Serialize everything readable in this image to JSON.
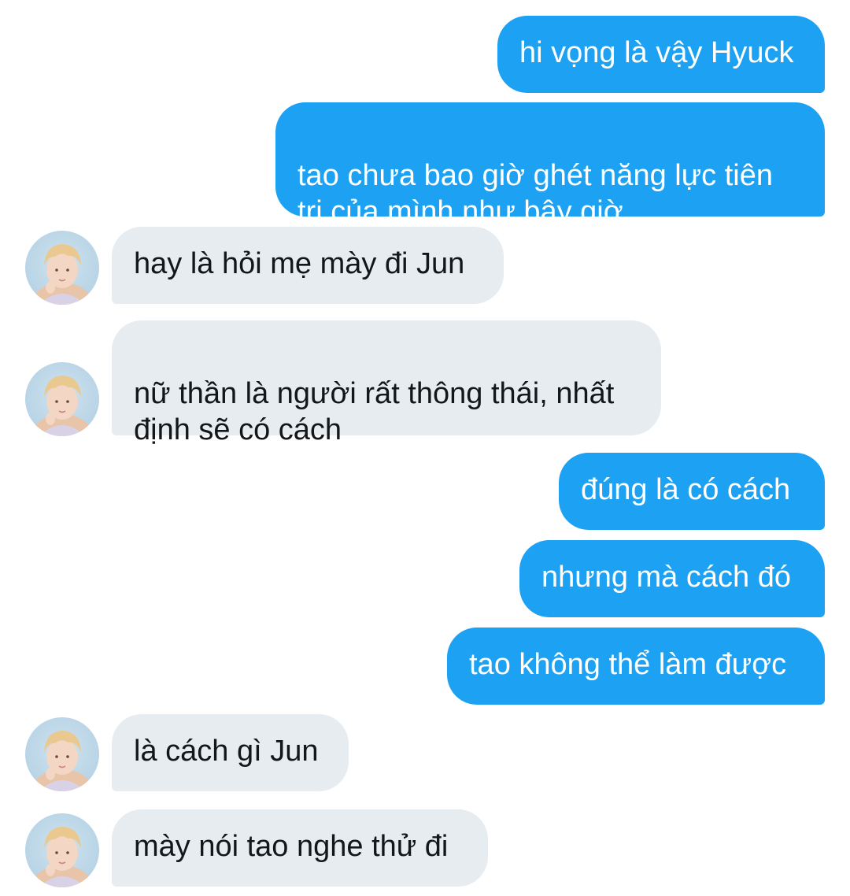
{
  "messages": [
    {
      "side": "out",
      "text": "hi vọng là vậy Hyuck"
    },
    {
      "side": "out",
      "text": "tao chưa bao giờ ghét năng lực tiên\ntri của mình như bây giờ"
    },
    {
      "side": "in",
      "text": "hay là hỏi mẹ mày đi Jun"
    },
    {
      "side": "in",
      "text": "nữ thần là người rất thông thái, nhất\nđịnh sẽ có cách"
    },
    {
      "side": "out",
      "text": "đúng là có cách"
    },
    {
      "side": "out",
      "text": "nhưng mà cách đó"
    },
    {
      "side": "out",
      "text": "tao không thể làm được"
    },
    {
      "side": "in",
      "text": "là cách gì Jun"
    },
    {
      "side": "in",
      "text": "mày nói tao nghe thử đi"
    }
  ],
  "colors": {
    "outgoing_bubble": "#1da1f2",
    "incoming_bubble": "#e6ecf0",
    "outgoing_text": "#ffffff",
    "incoming_text": "#14171a"
  },
  "avatar_icon": "user-avatar-icon"
}
